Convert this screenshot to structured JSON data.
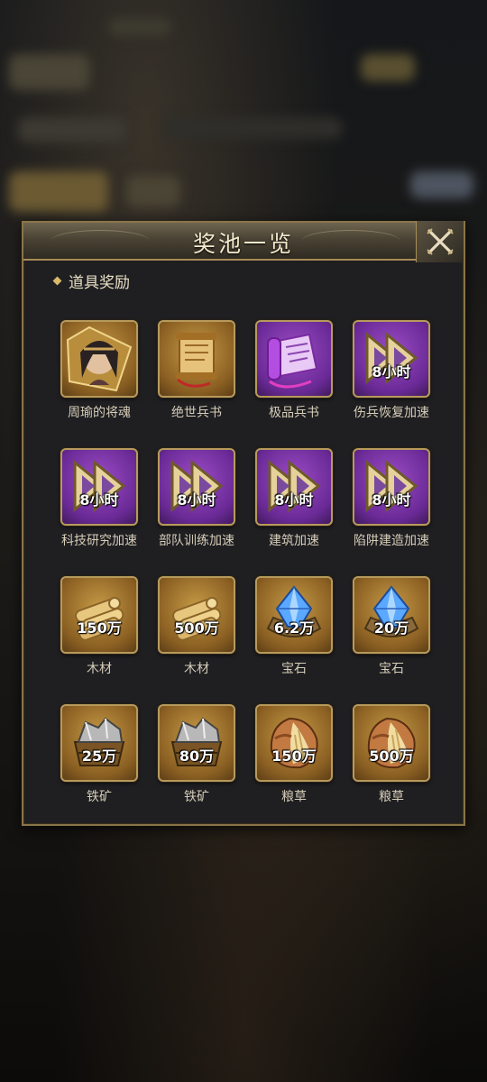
{
  "dialog": {
    "title": "奖池一览",
    "section_title": "道具奖励"
  },
  "items": [
    {
      "name": "周瑜的将魂",
      "qty": "",
      "icon": "hero-portrait-icon",
      "bg": "gold"
    },
    {
      "name": "绝世兵书",
      "qty": "",
      "icon": "scroll-icon",
      "bg": "gold"
    },
    {
      "name": "极品兵书",
      "qty": "",
      "icon": "purple-scroll-icon",
      "bg": "purple"
    },
    {
      "name": "伤兵恢复加速",
      "qty": "8小时",
      "icon": "speedup-arrow-icon",
      "bg": "purple"
    },
    {
      "name": "科技研究加速",
      "qty": "8小时",
      "icon": "speedup-arrow-icon",
      "bg": "purple"
    },
    {
      "name": "部队训练加速",
      "qty": "8小时",
      "icon": "speedup-arrow-icon",
      "bg": "purple"
    },
    {
      "name": "建筑加速",
      "qty": "8小时",
      "icon": "speedup-arrow-icon",
      "bg": "purple"
    },
    {
      "name": "陷阱建造加速",
      "qty": "8小时",
      "icon": "speedup-arrow-icon",
      "bg": "purple"
    },
    {
      "name": "木材",
      "qty": "150万",
      "icon": "wood-icon",
      "bg": "gold"
    },
    {
      "name": "木材",
      "qty": "500万",
      "icon": "wood-icon",
      "bg": "gold"
    },
    {
      "name": "宝石",
      "qty": "6.2万",
      "icon": "gem-icon",
      "bg": "gold"
    },
    {
      "name": "宝石",
      "qty": "20万",
      "icon": "gem-icon",
      "bg": "gold"
    },
    {
      "name": "铁矿",
      "qty": "25万",
      "icon": "iron-ore-icon",
      "bg": "gold"
    },
    {
      "name": "铁矿",
      "qty": "80万",
      "icon": "iron-ore-icon",
      "bg": "gold"
    },
    {
      "name": "粮草",
      "qty": "150万",
      "icon": "grain-sack-icon",
      "bg": "gold"
    },
    {
      "name": "粮草",
      "qty": "500万",
      "icon": "grain-sack-icon",
      "bg": "gold"
    }
  ]
}
